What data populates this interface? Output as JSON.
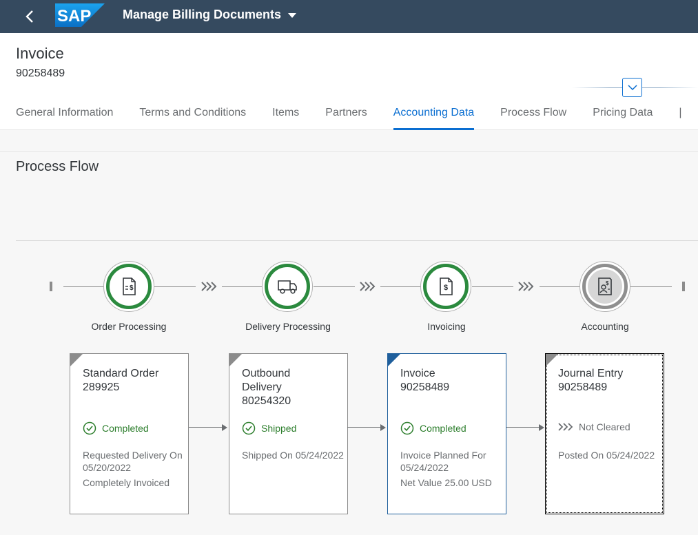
{
  "shell": {
    "app_title": "Manage Billing Documents",
    "logo_text": "SAP"
  },
  "header": {
    "object_title": "Invoice",
    "object_id": "90258489"
  },
  "tabs": [
    {
      "label": "General Information",
      "active": false
    },
    {
      "label": "Terms and Conditions",
      "active": false
    },
    {
      "label": "Items",
      "active": false
    },
    {
      "label": "Partners",
      "active": false
    },
    {
      "label": "Accounting Data",
      "active": true
    },
    {
      "label": "Process Flow",
      "active": false
    },
    {
      "label": "Pricing Data",
      "active": false
    }
  ],
  "section": {
    "title": "Process Flow"
  },
  "lanes": [
    {
      "label": "Order Processing",
      "icon": "document-dollar-icon",
      "state": "completed"
    },
    {
      "label": "Delivery Processing",
      "icon": "truck-icon",
      "state": "completed"
    },
    {
      "label": "Invoicing",
      "icon": "document-dollar-icon",
      "state": "completed"
    },
    {
      "label": "Accounting",
      "icon": "contact-card-icon",
      "state": "neutral"
    }
  ],
  "cards": [
    {
      "title_line1": "Standard Order",
      "title_line2": "289925",
      "title_line3": "",
      "status": "Completed",
      "detail1": "Requested Delivery On 05/20/2022",
      "detail2": "Completely Invoiced"
    },
    {
      "title_line1": "Outbound",
      "title_line2": "Delivery",
      "title_line3": "80254320",
      "status": "Shipped",
      "detail1": "Shipped On 05/24/2022",
      "detail2": ""
    },
    {
      "title_line1": "Invoice",
      "title_line2": "90258489",
      "title_line3": "",
      "status": "Completed",
      "detail1": "Invoice Planned For 05/24/2022",
      "detail2": "Net Value 25.00 USD"
    },
    {
      "title_line1": "Journal Entry",
      "title_line2": "90258489",
      "title_line3": "",
      "status": "Not Cleared",
      "detail1": "Posted On 05/24/2022",
      "detail2": ""
    }
  ],
  "colors": {
    "shell_bg": "#354a5f",
    "accent": "#0a6ed1",
    "positive": "#2b8a3e",
    "neutral": "#8f8f8f"
  }
}
